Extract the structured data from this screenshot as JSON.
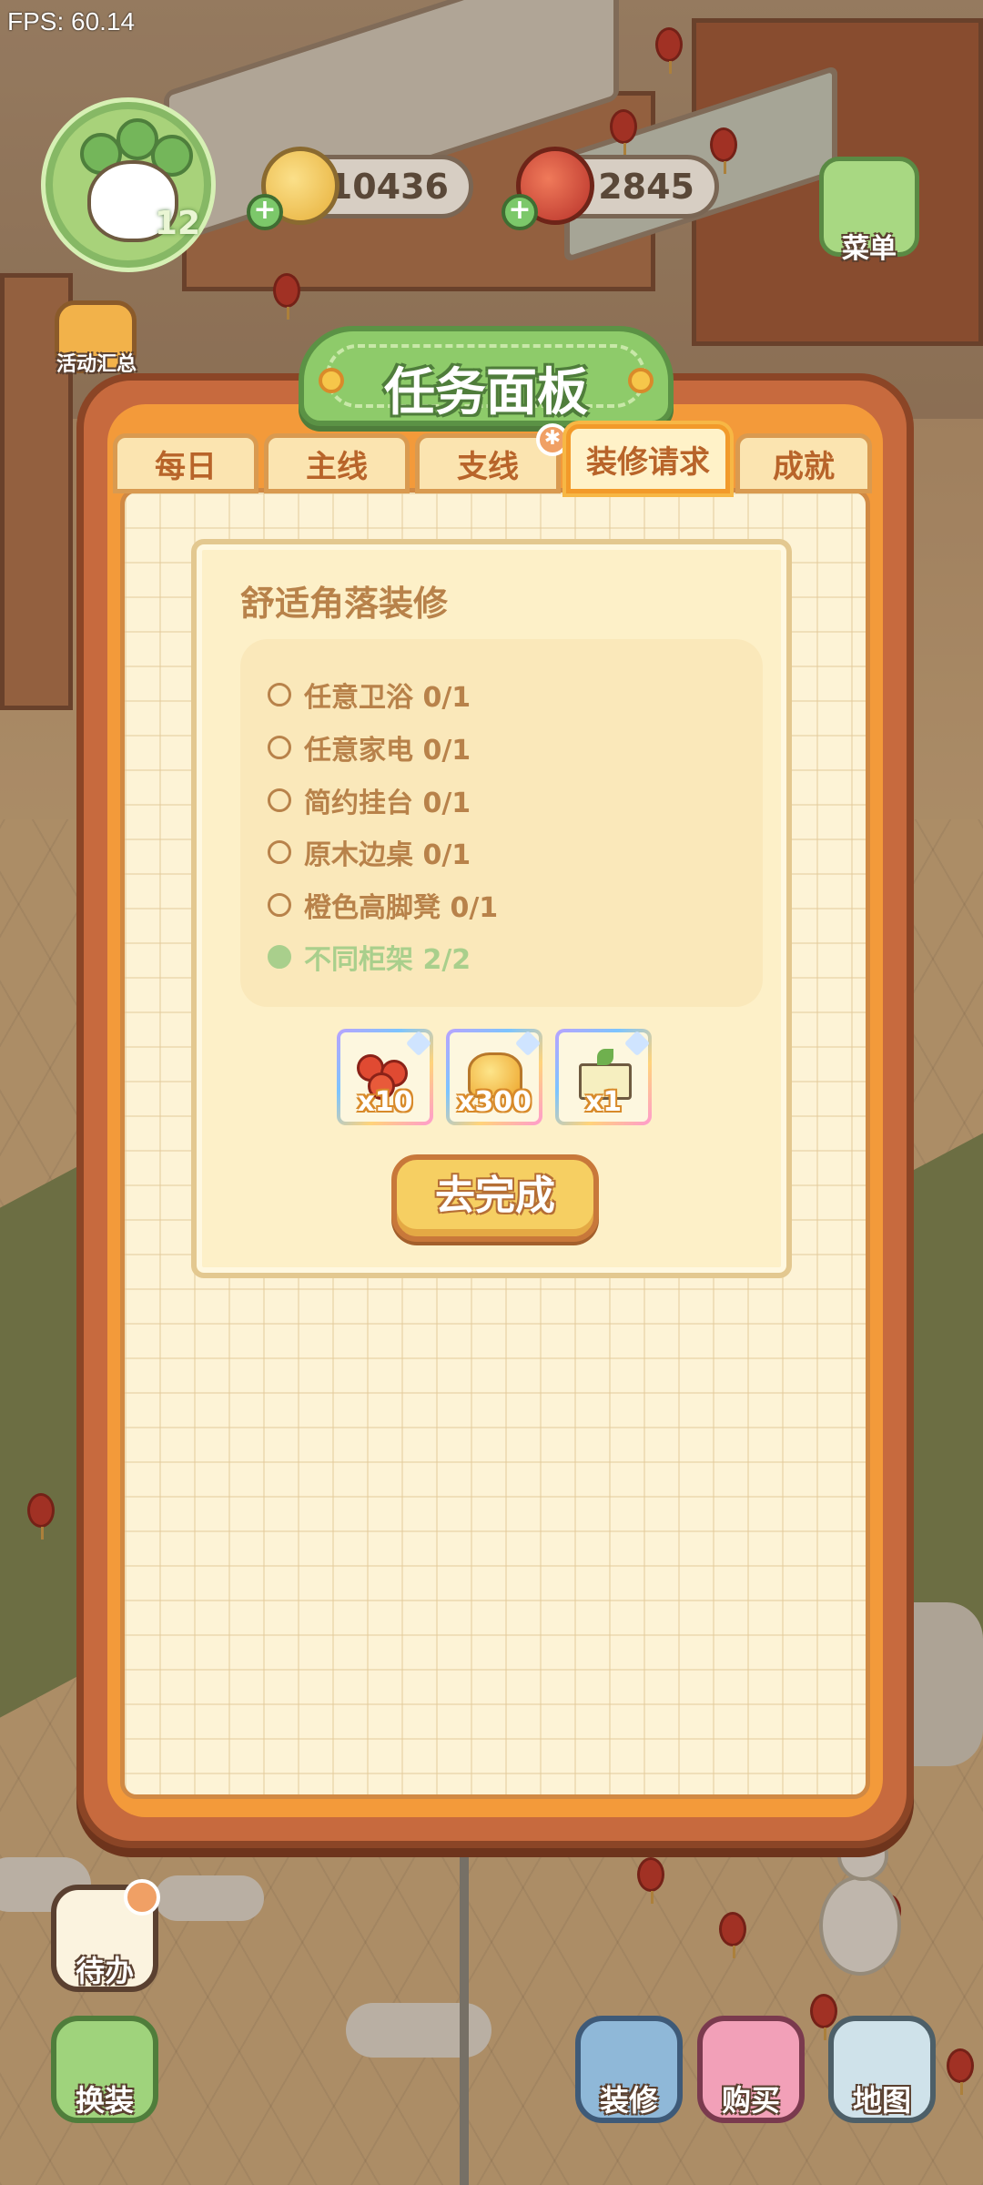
{
  "hud": {
    "fps": "FPS: 60.14",
    "level": "12",
    "coins": "10436",
    "cherries": "2845",
    "plus": "+"
  },
  "side": {
    "menu": "菜单",
    "events": "活动汇总"
  },
  "panel": {
    "title": "任务面板",
    "tabs": [
      "每日",
      "主线",
      "支线",
      "装修请求",
      "成就"
    ],
    "active_tab": "装修请求",
    "card": {
      "title": "舒适角落装修",
      "tasks": [
        {
          "label": "任意卫浴 0/1",
          "done": false
        },
        {
          "label": "任意家电 0/1",
          "done": false
        },
        {
          "label": "简约挂台 0/1",
          "done": false
        },
        {
          "label": "原木边桌 0/1",
          "done": false
        },
        {
          "label": "橙色高脚凳 0/1",
          "done": false
        },
        {
          "label": "不同柜架 2/2",
          "done": true
        }
      ],
      "rewards": [
        {
          "icon": "cherry-icon",
          "qty": "x10"
        },
        {
          "icon": "gold-coins-icon",
          "qty": "x300"
        },
        {
          "icon": "sprout-box-icon",
          "qty": "x1"
        }
      ],
      "action": "去完成"
    }
  },
  "bottom": {
    "todo": "待办",
    "dress": "换装",
    "decorate": "装修",
    "shop": "购买",
    "map": "地图"
  },
  "colors": {
    "panel_frame": "#c76a3e",
    "panel_orange": "#f39a3a",
    "title_green": "#8ecb6a",
    "task_text": "#b8824a",
    "done_green": "#a9cf8c"
  }
}
